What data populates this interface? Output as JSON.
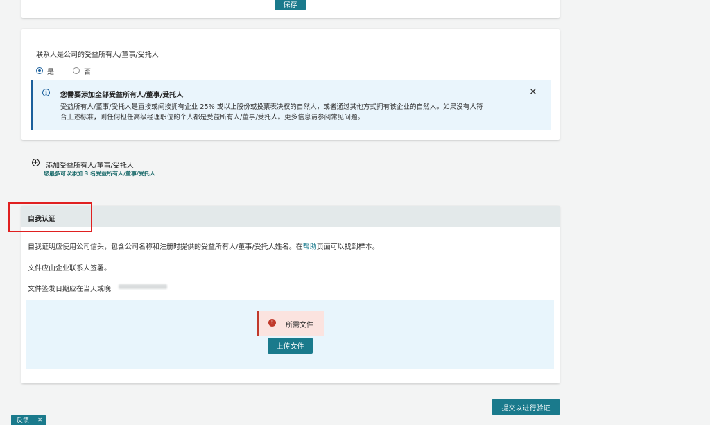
{
  "top_card": {
    "save_label": "保存"
  },
  "contact": {
    "question": "联系人是公司的受益所有人/董事/受托人",
    "yes_label": "是",
    "no_label": "否",
    "selected": "yes"
  },
  "info": {
    "title": "您需要添加全部受益所有人/董事/受托人",
    "line1": "受益所有人/董事/受托人是直接或间接拥有企业 25% 或以上股份或投票表决权的自然人，或者通过其他方式拥有该企业的自然人。如果没有人符",
    "line2": "合上述标准，则任何担任高级经理职位的个人都是受益所有人/董事/受托人。更多信息请参阅常见问题。"
  },
  "add_owner": {
    "label": "添加受益所有人/董事/受托人",
    "hint": "您最多可以添加 3 名受益所有人/董事/受托人"
  },
  "self_cert": {
    "header": "自我认证",
    "p1_before": "自我证明应使用公司信头，包含公司名称和注册时提供的受益所有人/董事/受托人姓名。在",
    "p1_link": "帮助",
    "p1_after": "页面可以找到样本。",
    "p2": "文件应由企业联系人签署。",
    "p3": "文件签发日期应在当天或晚",
    "required_label": "所需文件",
    "upload_label": "上传文件"
  },
  "submit_label": "提交以进行验证",
  "feedback_label": "反馈",
  "colors": {
    "accent": "#1a7a8c",
    "info_border": "#1a5f9c",
    "error": "#c0392b",
    "highlight": "#e02020"
  }
}
